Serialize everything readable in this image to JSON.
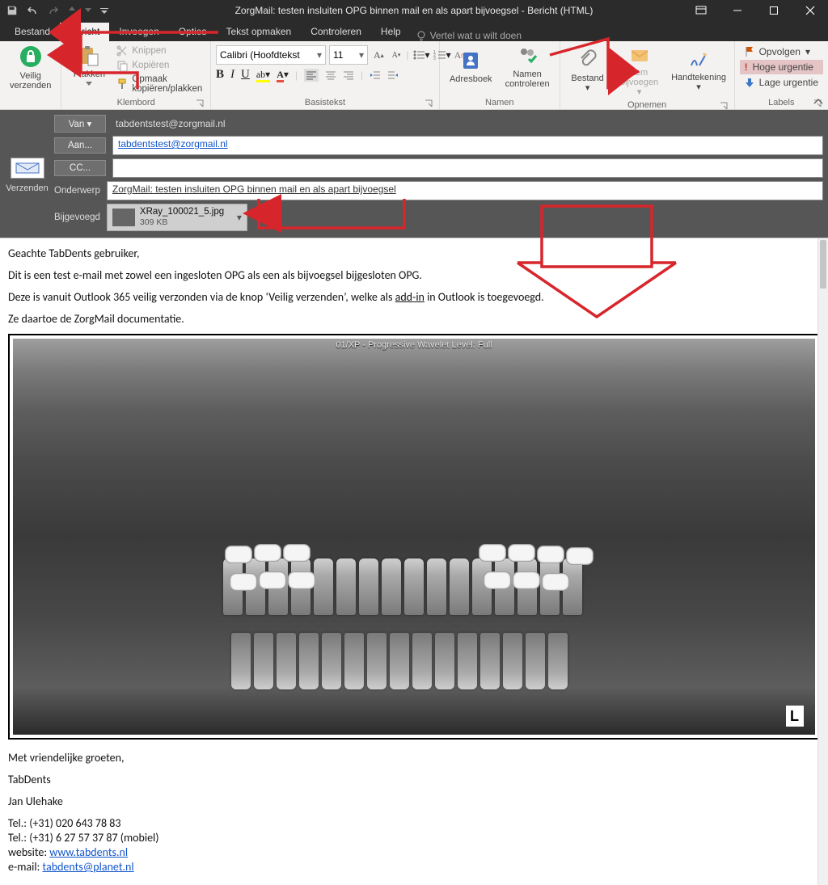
{
  "window": {
    "title": "ZorgMail: testen insluiten OPG binnen mail en als apart bijvoegsel  -  Bericht (HTML)"
  },
  "qat": {
    "save": "Opslaan",
    "undo": "Ongedaan maken",
    "redo": "Opnieuw"
  },
  "menu": {
    "bestand": "Bestand",
    "bericht": "Bericht",
    "invoegen": "Invoegen",
    "opties": "Opties",
    "tekst": "Tekst opmaken",
    "controleren": "Controleren",
    "help": "Help",
    "tell_placeholder": "Vertel wat u wilt doen"
  },
  "ribbon": {
    "veilig": {
      "line1": "Veilig",
      "line2": "verzenden"
    },
    "klembord": {
      "label": "Klembord",
      "plakken": "Plakken",
      "knippen": "Knippen",
      "kopieren": "Kopiëren",
      "opmaak": "Opmaak kopiëren/plakken"
    },
    "basistekst": {
      "label": "Basistekst",
      "font": "Calibri (Hoofdtekst",
      "size": "11"
    },
    "namen": {
      "label": "Namen",
      "adresboek": "Adresboek",
      "controle1": "Namen",
      "controle2": "controleren"
    },
    "opnemen": {
      "label": "Opnemen",
      "bestand": "Bestand",
      "item1": "Item",
      "item2": "bijvoegen",
      "sign": "Handtekening"
    },
    "labels": {
      "label": "Labels",
      "opvolgen": "Opvolgen",
      "hoge": "Hoge urgentie",
      "lage": "Lage urgentie"
    }
  },
  "compose": {
    "verzenden": "Verzenden",
    "van_btn": "Van",
    "van_value": "tabdentstest@zorgmail.nl",
    "aan_btn": "Aan...",
    "aan_value": "tabdentstest@zorgmail.nl",
    "cc_btn": "CC...",
    "cc_value": "",
    "onderwerp_lbl": "Onderwerp",
    "onderwerp_value": "ZorgMail: testen insluiten OPG binnen mail en als apart bijvoegsel",
    "bijgevoegd_lbl": "Bijgevoegd",
    "attachment": {
      "name": "XRay_100021_5.jpg",
      "size": "309 KB"
    }
  },
  "body": {
    "greet": "Geachte TabDents gebruiker,",
    "p1": "Dit is een test e-mail met zowel een ingesloten OPG als een als bijvoegsel bijgesloten OPG.",
    "p2_a": "Deze is vanuit Outlook 365 veilig verzonden via de knop ‘Veilig verzenden’, welke als ",
    "p2_link": "add-in",
    "p2_b": " in Outlook is toegevoegd.",
    "p3": "Ze daartoe de ZorgMail documentatie.",
    "xray_title": "01/XP - Progressive Wavelet Level: Full",
    "signoff": "Met vriendelijke groeten,",
    "brand": "TabDents",
    "name": "Jan Ulehake",
    "tel1": "Tel.: (+31) 020 643 78 83",
    "tel2": "Tel.: (+31) 6 27 57 37 87 (mobiel)",
    "web_lbl": "website: ",
    "web_link": "www.tabdents.nl",
    "mail_lbl": "e-mail: ",
    "mail_link": "tabdents@planet.nl"
  }
}
